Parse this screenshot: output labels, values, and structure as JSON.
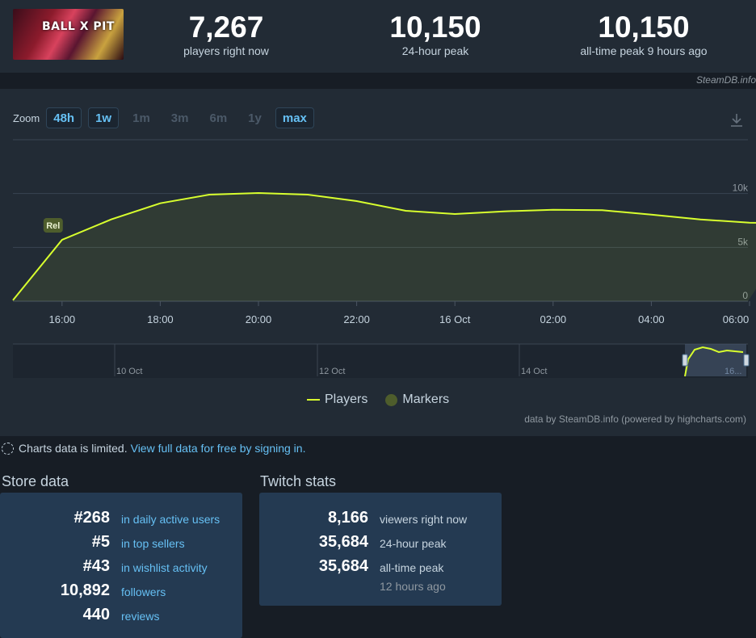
{
  "game": {
    "logo_text": "BALL X PIT"
  },
  "stats": [
    {
      "value": "7,267",
      "label": "players right now"
    },
    {
      "value": "10,150",
      "label": "24-hour peak"
    },
    {
      "value": "10,150",
      "label": "all-time peak 9 hours ago"
    }
  ],
  "site_credit": "SteamDB.info",
  "zoom": {
    "label": "Zoom",
    "buttons": [
      "48h",
      "1w",
      "1m",
      "3m",
      "6m",
      "1y",
      "max"
    ],
    "active": [
      "48h",
      "1w",
      "max"
    ]
  },
  "chart_data": {
    "type": "line",
    "series": [
      {
        "name": "Players",
        "color": "#d8ff2e",
        "x": [
          "15:00",
          "16:00",
          "17:00",
          "18:00",
          "19:00",
          "20:00",
          "21:00",
          "22:00",
          "23:00",
          "16 Oct 00:00",
          "01:00",
          "02:00",
          "03:00",
          "04:00",
          "05:00",
          "06:00",
          "06:15"
        ],
        "values": [
          100,
          5700,
          7600,
          9100,
          9900,
          10050,
          9900,
          9300,
          8400,
          8100,
          8350,
          8500,
          8450,
          8050,
          7600,
          7300,
          7200
        ]
      }
    ],
    "x_tick_labels": [
      "16:00",
      "18:00",
      "20:00",
      "22:00",
      "16 Oct",
      "02:00",
      "04:00",
      "06:00"
    ],
    "y_tick_labels": [
      "0",
      "5k",
      "10k"
    ],
    "ylim": [
      0,
      15000
    ],
    "marker": {
      "label": "Rel",
      "x": "16:00"
    },
    "navigator_labels": [
      "10 Oct",
      "12 Oct",
      "14 Oct",
      "16..."
    ],
    "legend": [
      "Players",
      "Markers"
    ],
    "marker_color": "#4e5d2c",
    "credit": "data by SteamDB.info (powered by highcharts.com)"
  },
  "limited_notice": {
    "text": "Charts data is limited.",
    "link": "View full data for free by signing in."
  },
  "store": {
    "title": "Store data",
    "rows": [
      {
        "value": "#268",
        "label": "in daily active users"
      },
      {
        "value": "#5",
        "label": "in top sellers"
      },
      {
        "value": "#43",
        "label": "in wishlist activity"
      },
      {
        "value": "10,892",
        "label": "followers"
      },
      {
        "value": "440",
        "label": "reviews"
      }
    ]
  },
  "twitch": {
    "title": "Twitch stats",
    "rows": [
      {
        "value": "8,166",
        "label": "viewers right now"
      },
      {
        "value": "35,684",
        "label": "24-hour peak"
      },
      {
        "value": "35,684",
        "label": "all-time peak"
      }
    ],
    "sub": "12 hours ago"
  }
}
